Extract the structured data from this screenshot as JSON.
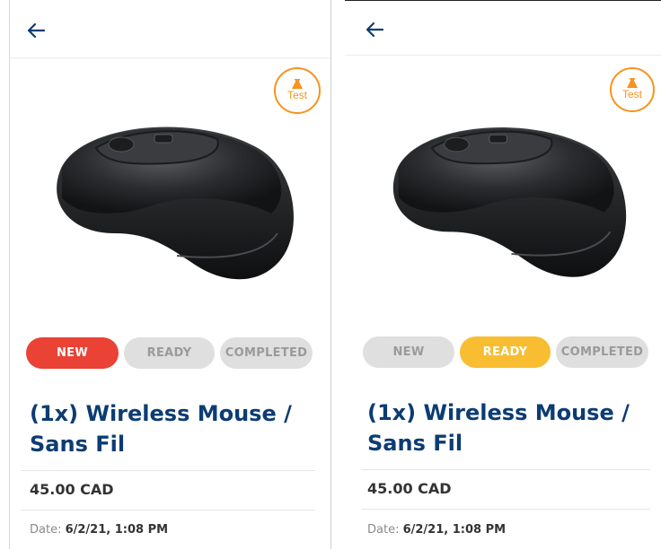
{
  "screens": [
    {
      "test_badge": {
        "label": "Test"
      },
      "statuses": [
        {
          "label": "NEW",
          "state": "active"
        },
        {
          "label": "READY",
          "state": "inactive"
        },
        {
          "label": "COMPLETED",
          "state": "inactive"
        }
      ],
      "product": {
        "title_line1": "(1x) Wireless Mouse /",
        "title_line2": "Sans Fil",
        "price": "45.00 CAD",
        "date_label": "Date:",
        "date_value": "6/2/21, 1:08 PM"
      }
    },
    {
      "test_badge": {
        "label": "Test"
      },
      "statuses": [
        {
          "label": "NEW",
          "state": "inactive"
        },
        {
          "label": "READY",
          "state": "active"
        },
        {
          "label": "COMPLETED",
          "state": "inactive"
        }
      ],
      "product": {
        "title_line1": "(1x) Wireless Mouse /",
        "title_line2": "Sans Fil",
        "price": "45.00 CAD",
        "date_label": "Date:",
        "date_value": "6/2/21, 1:08 PM"
      }
    }
  ],
  "colors": {
    "accent_blue": "#0c3c73",
    "badge_orange": "#f7931e",
    "new_red": "#ea4235",
    "ready_yellow": "#f8bd30",
    "inactive_gray": "#dfdfdf"
  }
}
